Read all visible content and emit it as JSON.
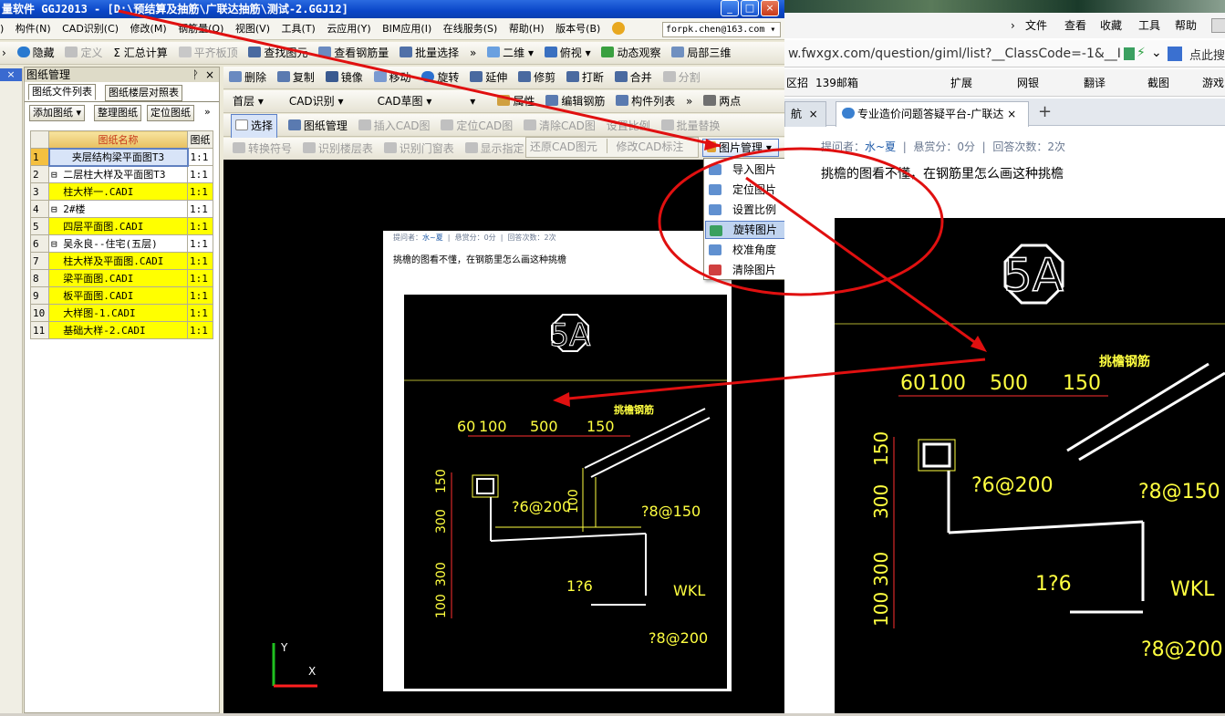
{
  "app": {
    "title": "量软件 GGJ2013 - [D:\\预结算及抽筋\\广联达抽筋\\测试-2.GGJ12]",
    "menu": [
      "构件(N)",
      "CAD识别(C)",
      "修改(M)",
      "钢筋量(Q)",
      "视图(V)",
      "工具(T)",
      "云应用(Y)",
      "BIM应用(I)",
      "在线服务(S)",
      "帮助(H)",
      "版本号(B)"
    ],
    "menu_prefix": ")",
    "email": "forpk.chen@163.com",
    "toolbar1": [
      "隐藏",
      "定义",
      "Σ 汇总计算",
      "平齐板顶",
      "查找图元",
      "查看钢筋量",
      "批量选择",
      "二维",
      "俯视",
      "动态观察",
      "局部三维"
    ],
    "toolbar2": [
      "删除",
      "复制",
      "镜像",
      "移动",
      "旋转",
      "延伸",
      "修剪",
      "打断",
      "合并",
      "分割"
    ],
    "toolbar3": {
      "floor": "首层",
      "cad_recog": "CAD识别",
      "cad_draft": "CAD草图",
      "props": "属性",
      "edit_rebar": "编辑钢筋",
      "member_list": "构件列表",
      "two_points": "两点"
    },
    "toolbar4": {
      "select": "选择",
      "drawing_mgmt": "图纸管理",
      "insert_cad": "插入CAD图",
      "locate_cad": "定位CAD图",
      "clear_cad": "清除CAD图",
      "set_scale": "设置比例",
      "batch_replace": "批量替换"
    },
    "toolbar5": {
      "convert_symbol": "转换符号",
      "recog_floor_table": "识别楼层表",
      "recog_door_window": "识别门窗表",
      "show_layer": "显示指定",
      "restore_cad": "还原CAD图元",
      "modify_cad": "修改CAD标注"
    },
    "pic_mgmt": "图片管理",
    "pic_menu": [
      "导入图片",
      "定位图片",
      "设置比例",
      "旋转图片",
      "校准角度",
      "清除图片"
    ],
    "panel": {
      "title": "图纸管理",
      "pin": "ⅹ",
      "close": "×",
      "tabs": [
        "图纸文件列表",
        "图纸楼层对照表"
      ],
      "buttons": [
        "添加图纸",
        "整理图纸",
        "定位图纸"
      ],
      "more": "»",
      "columns": [
        "图纸名称",
        "图纸"
      ],
      "rows": [
        {
          "num": "1",
          "name": "夹层结构梁平面图T3",
          "ratio": "1:1"
        },
        {
          "num": "2",
          "name": "⊟ 二层柱大样及平面图T3",
          "ratio": "1:1"
        },
        {
          "num": "3",
          "name": "  柱大样一.CADI",
          "ratio": "1:1"
        },
        {
          "num": "4",
          "name": "⊟ 2#楼",
          "ratio": "1:1"
        },
        {
          "num": "5",
          "name": "  四层平面图.CADI",
          "ratio": "1:1"
        },
        {
          "num": "6",
          "name": "⊟ 吴永良--住宅(五层)",
          "ratio": "1:1"
        },
        {
          "num": "7",
          "name": "  柱大样及平面图.CADI",
          "ratio": "1:1"
        },
        {
          "num": "8",
          "name": "  梁平面图.CADI",
          "ratio": "1:1"
        },
        {
          "num": "9",
          "name": "  板平面图.CADI",
          "ratio": "1:1"
        },
        {
          "num": "10",
          "name": "  大样图-1.CADI",
          "ratio": "1:1"
        },
        {
          "num": "11",
          "name": "  基础大样-2.CADI",
          "ratio": "1:1"
        }
      ]
    }
  },
  "drawing": {
    "meta_asker": "提问者：",
    "meta_user": "水~夏",
    "meta_bounty": "悬赏分：0分",
    "meta_answers": "回答次数：2次",
    "question": "挑檐的图看不懂，在钢筋里怎么画这种挑檐",
    "axis_mark": "5A",
    "dims": [
      "60",
      "100",
      "500",
      "150"
    ],
    "label_rebar": "挑檐钢筋",
    "rebar1": "?6@200",
    "rebar2": "?8@150",
    "rebar3": "1?6",
    "rebar4": "?8@200",
    "beam": "WKL",
    "vert_dims": [
      "150",
      "300",
      "300",
      "100",
      "100"
    ],
    "axis_y": "Y",
    "axis_x": "X"
  },
  "browser": {
    "menu": [
      "文件",
      "查看",
      "收藏",
      "工具",
      "帮助"
    ],
    "url": "w.fwxgx.com/question/giml/list?__ClassCode=-1&__I",
    "search_hint": "点此搜",
    "fav": [
      "区招",
      "139邮箱",
      "扩展",
      "网银",
      "翻译",
      "截图",
      "游戏"
    ],
    "tab_left": "航",
    "tab_active": "专业造价问题答疑平台-广联达",
    "new_tab": "+",
    "close_x": "×"
  }
}
